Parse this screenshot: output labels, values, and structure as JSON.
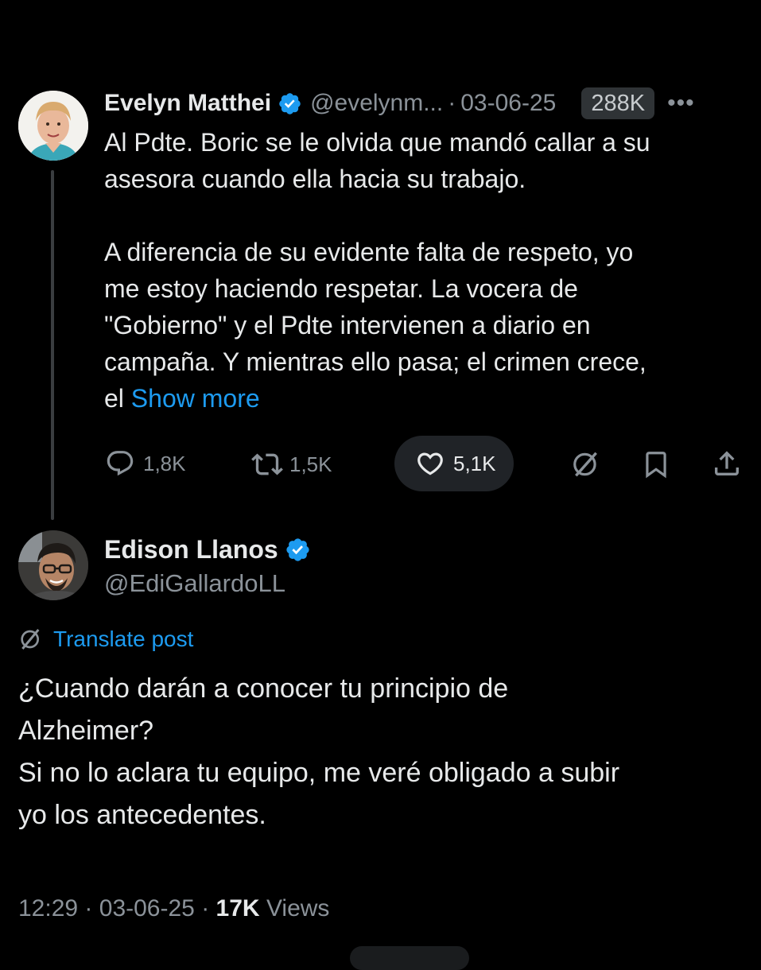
{
  "parent": {
    "name": "Evelyn Matthei",
    "handle": "@evelynm...",
    "separator": "·",
    "date": "03-06-25",
    "views_badge": "288K",
    "more": "•••",
    "text_lines": [
      "Al Pdte. Boric se le olvida que mandó callar a su",
      "asesora cuando ella hacia su trabajo.",
      "",
      "A diferencia de su evidente falta de respeto, yo",
      "me estoy haciendo respetar. La vocera de",
      "\"Gobierno\" y el Pdte intervienen a diario en",
      "campaña. Y mientras ello pasa; el crimen crece,"
    ],
    "last_line_prefix": "el",
    "show_more": "Show more",
    "actions": {
      "replies": "1,8K",
      "reposts": "1,5K",
      "likes": "5,1K"
    }
  },
  "reply": {
    "name": "Edison Llanos",
    "handle": "@EdiGallardoLL",
    "translate_label": "Translate post",
    "text_lines": [
      "¿Cuando darán a conocer tu principio de",
      "Alzheimer?",
      "Si no lo aclara tu equipo, me veré obligado a subir",
      "yo los antecedentes."
    ],
    "time": "12:29",
    "separator": "·",
    "date": "03-06-25",
    "views_count": "17K",
    "views_label": "Views"
  },
  "colors": {
    "background": "#000000",
    "text": "#e7e9ea",
    "muted": "#8b9299",
    "link": "#1d9bf0",
    "verified": "#1d9bf0"
  }
}
